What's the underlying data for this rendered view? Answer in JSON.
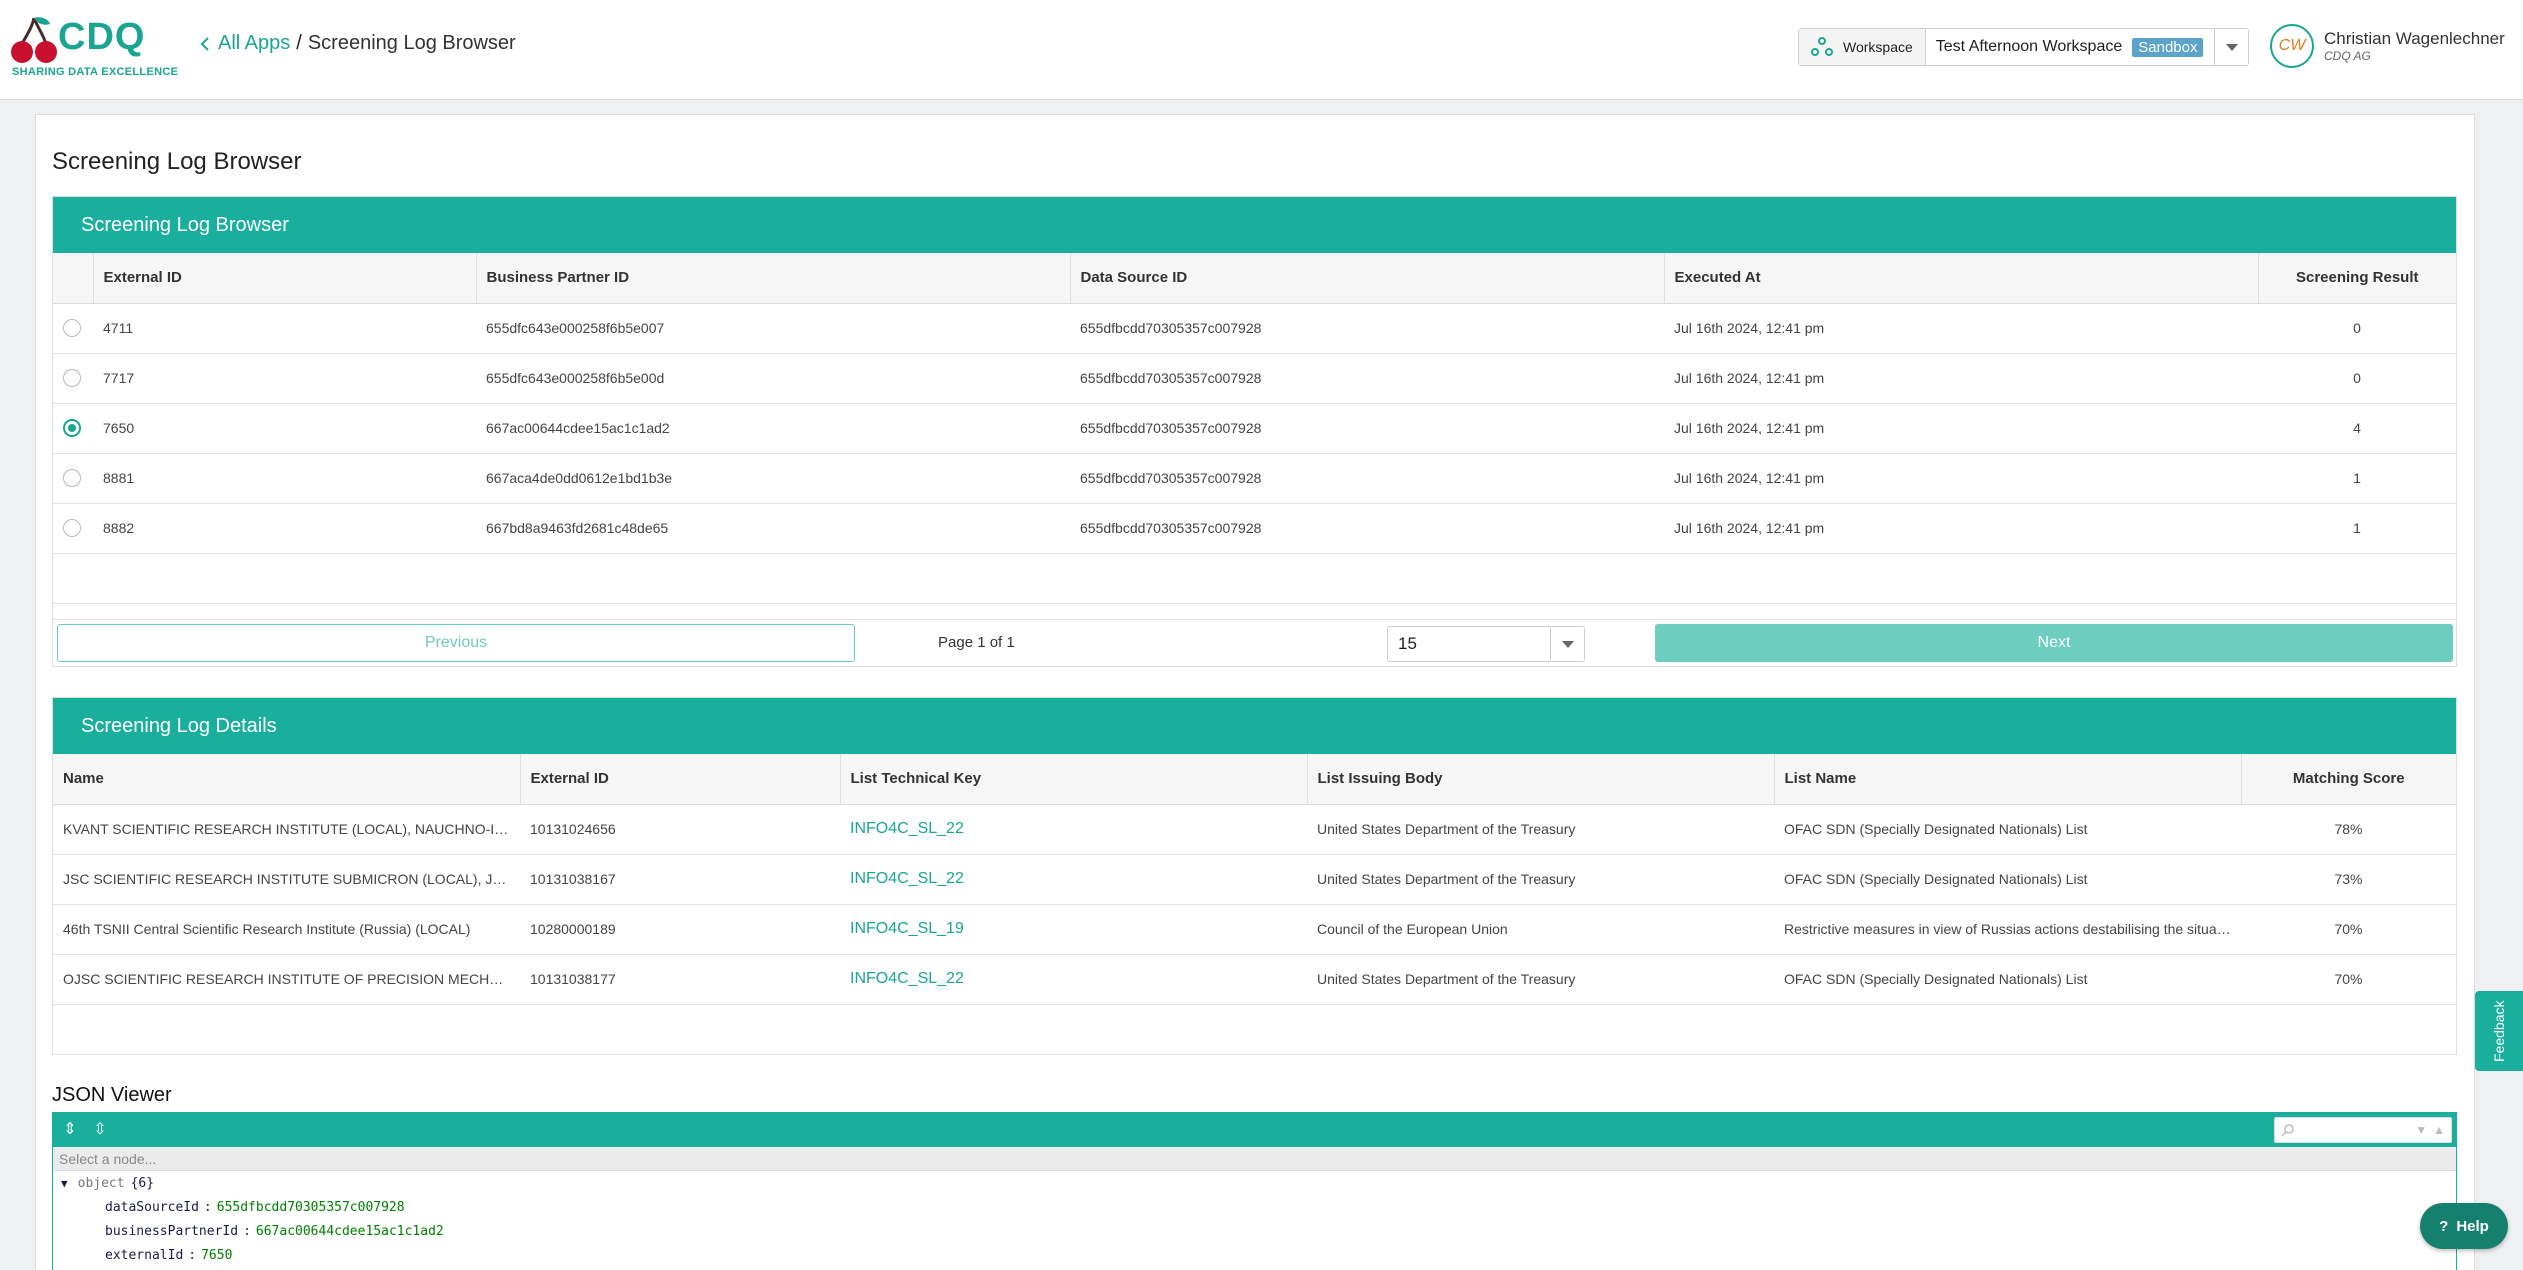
{
  "brand": {
    "name": "CDQ",
    "tagline": "SHARING DATA EXCELLENCE",
    "primary_color": "#1aa592",
    "header_color": "#1aaf9c"
  },
  "breadcrumb": {
    "back_label": "All Apps",
    "separator": "/",
    "current": "Screening Log Browser"
  },
  "workspace": {
    "label": "Workspace",
    "name": "Test Afternoon Workspace",
    "badge": "Sandbox"
  },
  "user": {
    "initials": "CW",
    "name": "Christian Wagenlechner",
    "org": "CDQ AG"
  },
  "page_title": "Screening Log Browser",
  "log_browser": {
    "title": "Screening Log Browser",
    "columns": [
      "External ID",
      "Business Partner ID",
      "Data Source ID",
      "Executed At",
      "Screening Result"
    ],
    "rows": [
      {
        "external_id": "4711",
        "bp_id": "655dfc643e000258f6b5e007",
        "ds_id": "655dfbcdd70305357c007928",
        "executed": "Jul 16th 2024, 12:41 pm",
        "result": "0",
        "selected": false
      },
      {
        "external_id": "7717",
        "bp_id": "655dfc643e000258f6b5e00d",
        "ds_id": "655dfbcdd70305357c007928",
        "executed": "Jul 16th 2024, 12:41 pm",
        "result": "0",
        "selected": false
      },
      {
        "external_id": "7650",
        "bp_id": "667ac00644cdee15ac1c1ad2",
        "ds_id": "655dfbcdd70305357c007928",
        "executed": "Jul 16th 2024, 12:41 pm",
        "result": "4",
        "selected": true
      },
      {
        "external_id": "8881",
        "bp_id": "667aca4de0dd0612e1bd1b3e",
        "ds_id": "655dfbcdd70305357c007928",
        "executed": "Jul 16th 2024, 12:41 pm",
        "result": "1",
        "selected": false
      },
      {
        "external_id": "8882",
        "bp_id": "667bd8a9463fd2681c48de65",
        "ds_id": "655dfbcdd70305357c007928",
        "executed": "Jul 16th 2024, 12:41 pm",
        "result": "1",
        "selected": false
      }
    ],
    "pager": {
      "previous": "Previous",
      "page_info": "Page 1 of 1",
      "page_size": "15",
      "next": "Next"
    }
  },
  "log_details": {
    "title": "Screening Log Details",
    "columns": [
      "Name",
      "External ID",
      "List Technical Key",
      "List Issuing Body",
      "List Name",
      "Matching Score"
    ],
    "rows": [
      {
        "name": "KVANT SCIENTIFIC RESEARCH INSTITUTE (LOCAL), NAUCHNO-ISSLEDOVATELSKI",
        "external_id": "10131024656",
        "key": "INFO4C_SL_22",
        "body": "United States Department of the Treasury",
        "list": "OFAC SDN (Specially Designated Nationals) List",
        "score": "78%"
      },
      {
        "name": "JSC SCIENTIFIC RESEARCH INSTITUTE SUBMICRON (LOCAL), JSC RESEARCH",
        "external_id": "10131038167",
        "key": "INFO4C_SL_22",
        "body": "United States Department of the Treasury",
        "list": "OFAC SDN (Specially Designated Nationals) List",
        "score": "73%"
      },
      {
        "name": "46th TSNII Central Scientific Research Institute (Russia) (LOCAL)",
        "external_id": "10280000189",
        "key": "INFO4C_SL_19",
        "body": "Council of the European Union",
        "list": "Restrictive measures in view of Russias actions destabilising the situation",
        "score": "70%"
      },
      {
        "name": "OJSC SCIENTIFIC RESEARCH INSTITUTE OF PRECISION MECHANICAL ENGINEERING",
        "external_id": "10131038177",
        "key": "INFO4C_SL_22",
        "body": "United States Department of the Treasury",
        "list": "OFAC SDN (Specially Designated Nationals) List",
        "score": "70%"
      }
    ]
  },
  "json_viewer": {
    "title": "JSON Viewer",
    "node_placeholder": "Select a node...",
    "root_type": "object",
    "root_count": "{6}",
    "fields": [
      {
        "key": "dataSourceId",
        "value": "655dfbcdd70305357c007928"
      },
      {
        "key": "businessPartnerId",
        "value": "667ac00644cdee15ac1c1ad2"
      },
      {
        "key": "externalId",
        "value": "7650"
      }
    ]
  },
  "feedback": "Feedback",
  "help": "Help"
}
